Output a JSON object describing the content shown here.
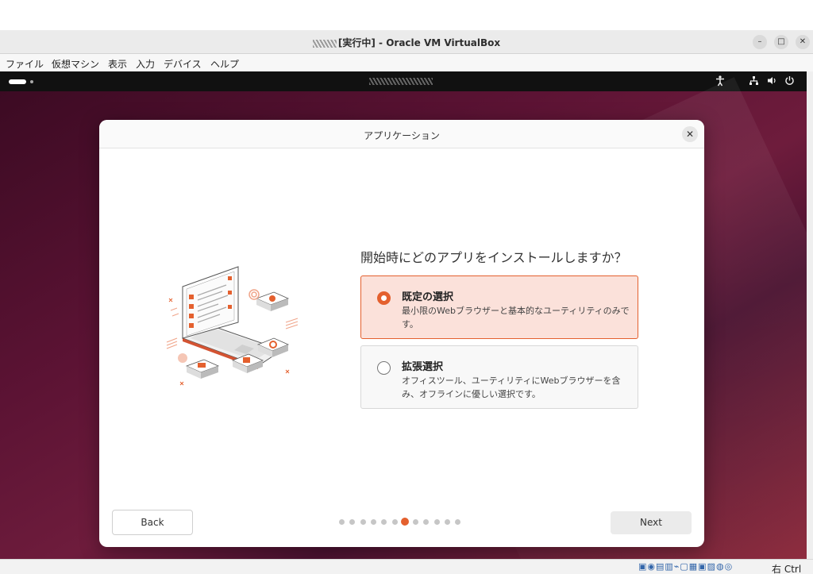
{
  "host_window": {
    "title": "[実行中] - Oracle VM VirtualBox",
    "menu": [
      "ファイル",
      "仮想マシン",
      "表示",
      "入力",
      "デバイス",
      "ヘルプ"
    ],
    "controls": {
      "minimize": "–",
      "maximize": "□",
      "close": "✕"
    }
  },
  "guest_topbar": {
    "tray_icons": [
      "accessibility-icon",
      "network-icon",
      "volume-icon",
      "power-icon"
    ]
  },
  "dialog": {
    "title": "アプリケーション",
    "close_glyph": "✕",
    "question": "開始時にどのアプリをインストールしますか？",
    "options": [
      {
        "title": "既定の選択",
        "description": "最小限のWebブラウザーと基本的なユーティリティのみです。",
        "selected": true
      },
      {
        "title": "拡張選択",
        "description": "オフィスツール、ユーティリティにWebブラウザーを含み、オフラインに優しい選択です。",
        "selected": false
      }
    ],
    "back_label": "Back",
    "next_label": "Next",
    "pager": {
      "total": 12,
      "current": 6
    }
  },
  "status_bar": {
    "host_key": "右 Ctrl"
  },
  "colors": {
    "accent": "#e4602e",
    "selected_bg": "#fbe1da"
  }
}
